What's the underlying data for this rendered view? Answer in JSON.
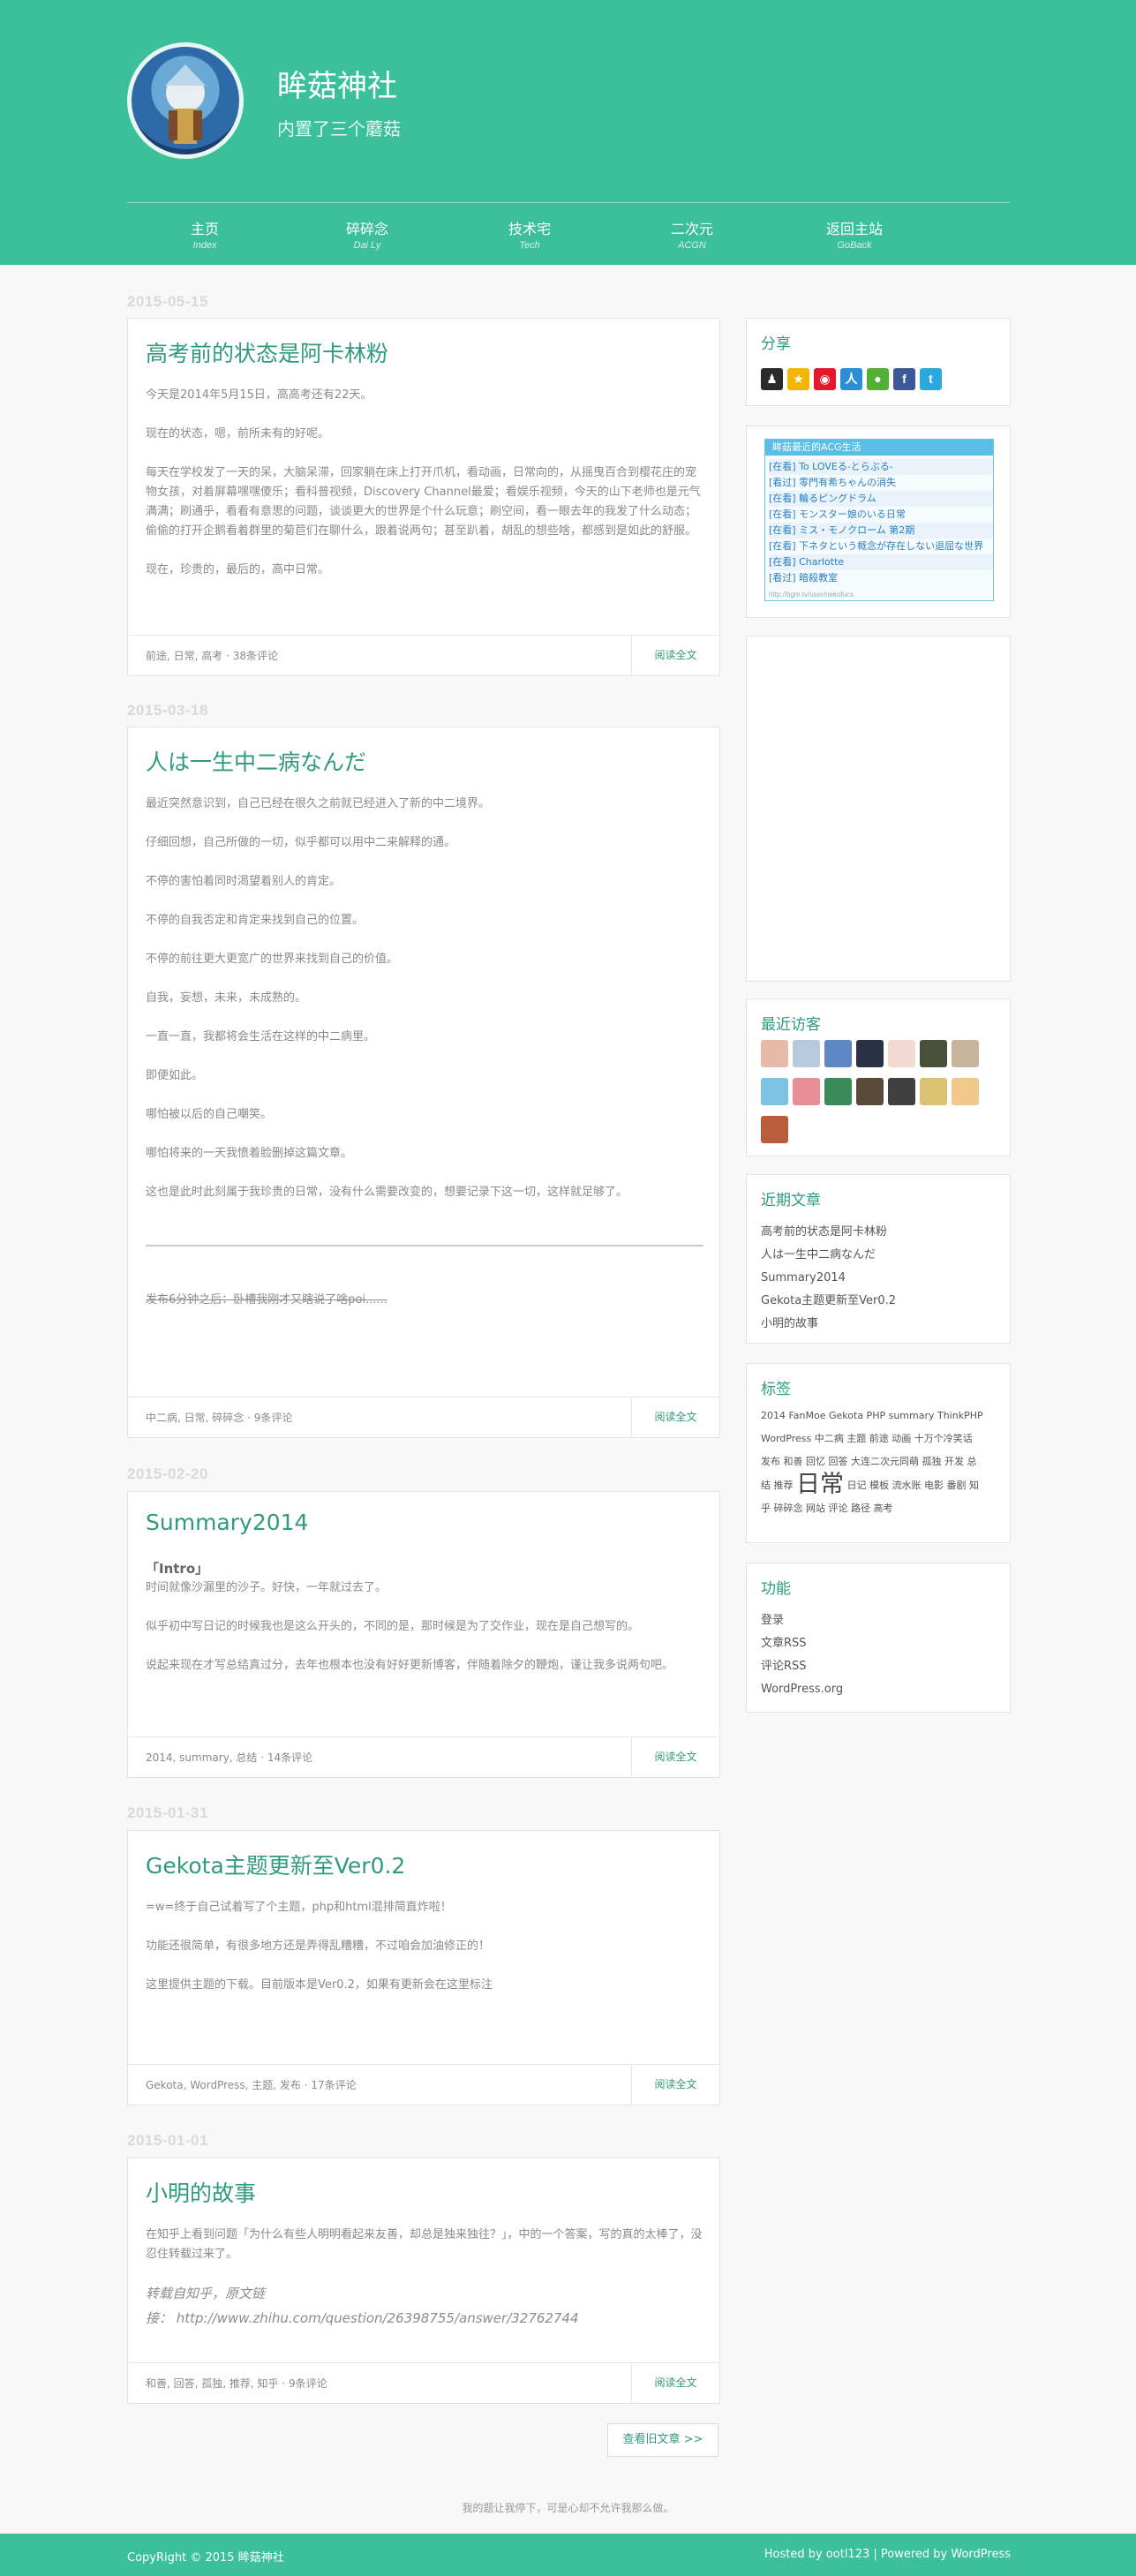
{
  "site": {
    "title": "眸菇神社",
    "description": "内置了三个蘑菇"
  },
  "nav": [
    {
      "cn": "主页",
      "en": "Index"
    },
    {
      "cn": "碎碎念",
      "en": "Dai Ly"
    },
    {
      "cn": "技术宅",
      "en": "Tech"
    },
    {
      "cn": "二次元",
      "en": "ACGN"
    },
    {
      "cn": "返回主站",
      "en": "GoBack"
    }
  ],
  "posts": [
    {
      "date": "2015-05-15",
      "title": "高考前的状态是阿卡林粉",
      "paragraphs": [
        "今天是2014年5月15日，高高考还有22天。",
        "现在的状态，嗯，前所未有的好呢。",
        "每天在学校发了一天的呆，大脑呆滞，回家躺在床上打开爪机，看动画，日常向的，从摇曳百合到樱花庄的宠物女孩，对着屏幕嘿嘿傻乐；看科普视频，Discovery Channel最爱；看娱乐视频，今天的山下老师也是元气满满；刷通乎，看看有意思的问题，谈谈更大的世界是个什么玩意；刷空间，看一眼去年的我发了什么动态；偷偷的打开企鹅看着群里的菊苣们在聊什么，跟着说两句；甚至趴着，胡乱的想些啥，都感到是如此的舒服。",
        "现在，珍贵的，最后的，高中日常。"
      ],
      "meta": "前途, 日常, 高考 · 38条评论",
      "read_more": "阅读全文"
    },
    {
      "date": "2015-03-18",
      "title": "人は一生中二病なんだ",
      "paragraphs": [
        "最近突然意识到，自己已经在很久之前就已经进入了新的中二境界。",
        "仔细回想，自己所做的一切，似乎都可以用中二来解释的通。",
        "不停的害怕着同时渴望着别人的肯定。",
        "不停的自我否定和肯定来找到自己的位置。",
        "不停的前往更大更宽广的世界来找到自己的价值。",
        "自我，妄想，未来，未成熟的。",
        "一直一直，我都将会生活在这样的中二病里。",
        "即便如此。",
        "哪怕被以后的自己嘲笑。",
        "哪怕将来的一天我愤着脸删掉这篇文章。",
        "这也是此时此刻属于我珍贵的日常，没有什么需要改变的，想要记录下这一切，这样就足够了。"
      ],
      "strike": "发布6分钟之后：卧槽我刚才又瞎说了啥poi......",
      "meta": "中二病, 日常, 碎碎念 · 9条评论",
      "read_more": "阅读全文"
    },
    {
      "date": "2015-02-20",
      "title": "Summary2014",
      "subhead": "「Intro」",
      "paragraphs": [
        "时间就像沙漏里的沙子。好快，一年就过去了。",
        "似乎初中写日记的时候我也是这么开头的，不同的是，那时候是为了交作业，现在是自己想写的。",
        "说起来现在才写总结真过分，去年也根本也没有好好更新博客，伴随着除夕的鞭炮，谨让我多说两句吧。"
      ],
      "meta": "2014, summary, 总结 · 14条评论",
      "read_more": "阅读全文"
    },
    {
      "date": "2015-01-31",
      "title": "Gekota主题更新至Ver0.2",
      "paragraphs": [
        "=w=终于自己试着写了个主题，php和html混排简直炸啦！",
        "功能还很简单，有很多地方还是弄得乱糟糟，不过咱会加油修正的！",
        "这里提供主题的下载。目前版本是Ver0.2，如果有更新会在这里标注"
      ],
      "meta": "Gekota, WordPress, 主题, 发布 · 17条评论",
      "read_more": "阅读全文"
    },
    {
      "date": "2015-01-01",
      "title": "小明的故事",
      "paragraphs": [
        "在知乎上看到问题「为什么有些人明明看起来友善，却总是独来独往？」，中的一个答案，写的真的太棒了，没忍住转载过来了。"
      ],
      "quotes": [
        "转载自知乎，原文链",
        "接： http://www.zhihu.com/question/26398755/answer/32762744"
      ],
      "meta": "和善, 回答, 孤独, 推荐, 知乎 · 9条评论",
      "read_more": "阅读全文"
    }
  ],
  "older_posts": "查看旧文章 >>",
  "sidebar": {
    "share_title": "分享",
    "share_icons": [
      "qq-icon",
      "qzone-icon",
      "weibo-icon",
      "renren-icon",
      "wechat-icon",
      "facebook-icon",
      "twitter-icon"
    ],
    "acg": {
      "header": "眸菇最近的ACG生活",
      "items": [
        "[在看] To LOVEる-とらぶる-",
        "[看过] 零門有希ちゃんの消失",
        "[在看] 輪るピングドラム",
        "[在看] モンスター娘のいる日常",
        "[在看] ミス・モノクローム 第2期",
        "[在看] 下ネタという概念が存在しない退屈な世界",
        "[在看] Charlotte",
        "[看过] 暗殺教室"
      ],
      "footer": "http://bgm.tv/user/nekofucs"
    },
    "visitors_title": "最近访客",
    "visitor_colors": [
      "#e7b9a6",
      "#b7c9dd",
      "#5d87c2",
      "#2a3346",
      "#f2d9d2",
      "#4a4f3c",
      "#c7b49b",
      "#7cc3e3",
      "#e98d96",
      "#3b8b5a",
      "#5a4a3a",
      "#404040",
      "#d9c370",
      "#f2c98a",
      "#b85e3a"
    ],
    "recent_title": "近期文章",
    "recent_posts": [
      "高考前的状态是阿卡林粉",
      "人は一生中二病なんだ",
      "Summary2014",
      "Gekota主题更新至Ver0.2",
      "小明的故事"
    ],
    "tags_title": "标签",
    "tags_line1": "2014 FanMoe Gekota PHP summary ThinkPHP",
    "tags_line2": "WordPress 中二病 主题 前途 动画 十万个冷笑话",
    "tags_line3": "发布 和善 回忆 回答 大连二次元同萌 孤独 开发 总",
    "tags_line4a": "结 推荐",
    "tags_big": "日常",
    "tags_line4b": "日记 模板 流水账 电影 番剧 知",
    "tags_line5": "乎 碎碎念 网站 评论 路径 高考",
    "func_title": "功能",
    "func_items": [
      "登录",
      "文章RSS",
      "评论RSS",
      "WordPress.org"
    ]
  },
  "footer": {
    "note": "我的题让我停下，可是心却不允许我那么做。",
    "copyright": "CopyRight © 2015 眸菇神社",
    "hosted": "Hosted by ootl123 | Powered by WordPress"
  }
}
